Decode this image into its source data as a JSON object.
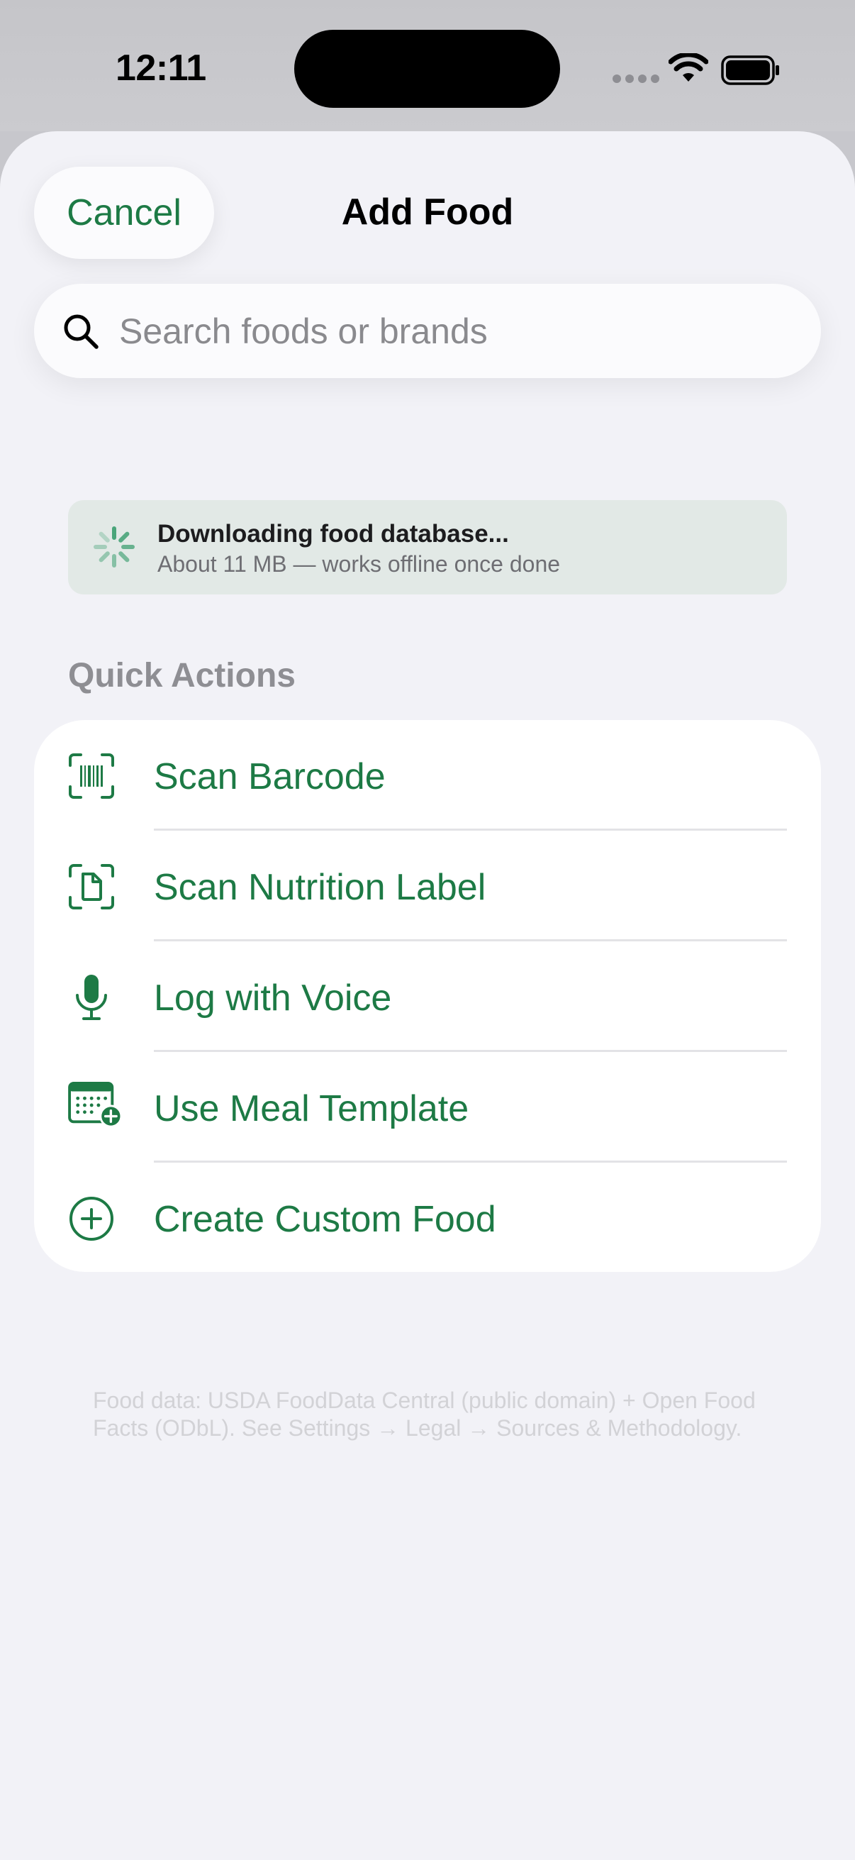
{
  "status_bar": {
    "time": "12:11"
  },
  "header": {
    "cancel_label": "Cancel",
    "title": "Add Food"
  },
  "search": {
    "placeholder": "Search foods or brands",
    "value": ""
  },
  "download_banner": {
    "title": "Downloading food database...",
    "subtitle": "About 11 MB — works offline once done"
  },
  "quick_actions": {
    "header": "Quick Actions",
    "items": [
      {
        "label": "Scan Barcode",
        "icon": "barcode-scan-icon"
      },
      {
        "label": "Scan Nutrition Label",
        "icon": "document-scan-icon"
      },
      {
        "label": "Log with Voice",
        "icon": "microphone-icon"
      },
      {
        "label": "Use Meal Template",
        "icon": "calendar-add-icon"
      },
      {
        "label": "Create Custom Food",
        "icon": "plus-circle-icon"
      }
    ]
  },
  "footer": {
    "note": "Food data: USDA FoodData Central (public domain) + Open Food Facts (ODbL). See Settings → Legal → Sources & Methodology."
  },
  "colors": {
    "accent": "#1d7a45",
    "sheet_background": "#f2f2f7",
    "banner_background": "#e2e9e6",
    "secondary_text": "#8e8e93"
  }
}
